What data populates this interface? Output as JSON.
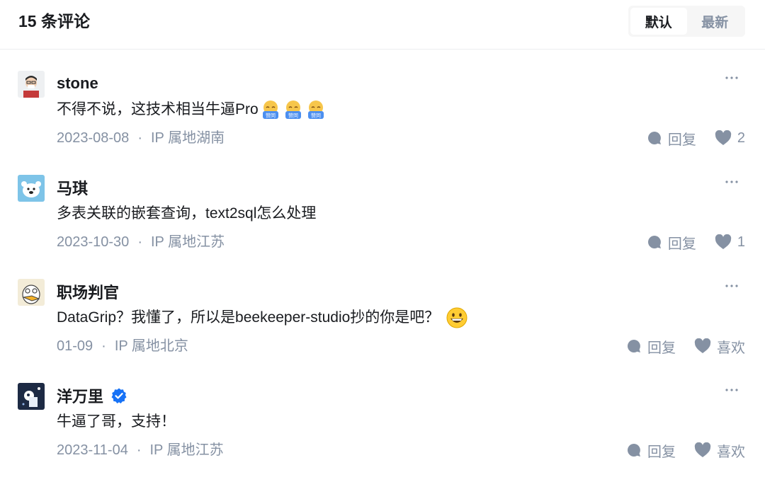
{
  "header": {
    "title": "15 条评论",
    "sort_options": [
      "默认",
      "最新"
    ],
    "sort_selected": "默认"
  },
  "comments": [
    {
      "name": "stone",
      "text": "不得不说，这技术相当牛逼Pro",
      "stickers": [
        "赞同",
        "赞同",
        "赞同"
      ],
      "date": "2023-08-08",
      "location": "IP 属地湖南",
      "reply_label": "回复",
      "likes": "2"
    },
    {
      "name": "马琪",
      "text": "多表关联的嵌套查询，text2sql怎么处理",
      "date": "2023-10-30",
      "location": "IP 属地江苏",
      "reply_label": "回复",
      "likes": "1"
    },
    {
      "name": "职场判官",
      "text": "DataGrip？我懂了，所以是beekeeper-studio抄的你是吧？",
      "date": "01-09",
      "location": "IP 属地北京",
      "reply_label": "回复",
      "likes": "喜欢"
    },
    {
      "name": "洋万里",
      "text": "牛逼了哥，支持！",
      "date": "2023-11-04",
      "location": "IP 属地江苏",
      "reply_label": "回复",
      "likes": "喜欢"
    }
  ],
  "icons": {
    "more": "more-horizontal-icon",
    "reply": "comment-bubble-icon",
    "like": "heart-icon",
    "verified": "verified-badge-icon",
    "grin": "grinning-face-emoji"
  },
  "colors": {
    "text": "#191b1f",
    "secondary": "#8591a3",
    "divider": "#ebedf0",
    "verified": "#1772f6"
  }
}
